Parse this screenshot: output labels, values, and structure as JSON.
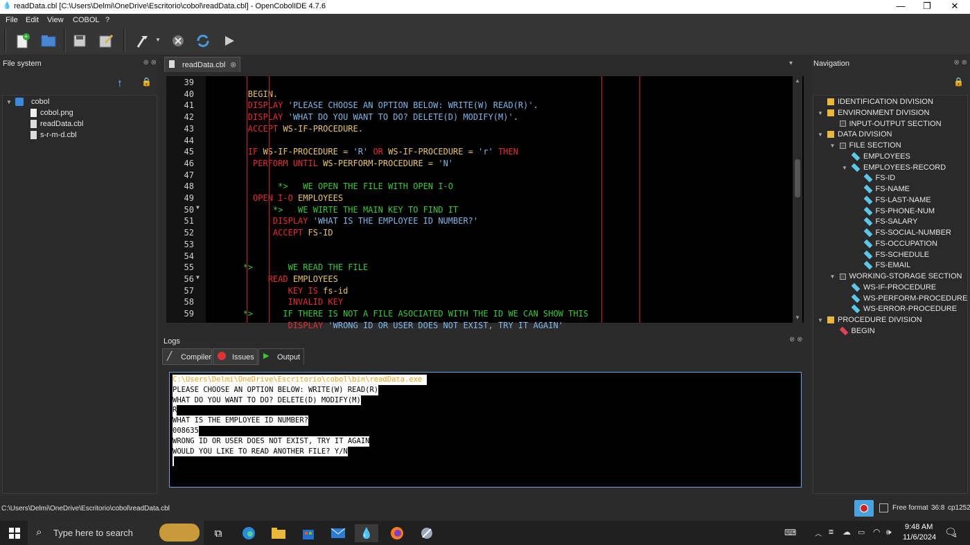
{
  "window": {
    "title": "readData.cbl [C:\\Users\\Delmi\\OneDrive\\Escritorio\\cobol\\readData.cbl] - OpenCobolIDE 4.7.6"
  },
  "menu": [
    "File",
    "Edit",
    "View",
    "COBOL",
    "?"
  ],
  "file_system": {
    "title": "File system",
    "root": "cobol",
    "files": [
      "cobol.png",
      "readData.cbl",
      "s-r-m-d.cbl"
    ]
  },
  "editor": {
    "tab": "readData.cbl",
    "lines": [
      {
        "n": "39",
        "segs": [
          [
            "",
            "w"
          ]
        ]
      },
      {
        "n": "40",
        "segs": [
          [
            "        BEGIN.",
            "y"
          ]
        ]
      },
      {
        "n": "41",
        "segs": [
          [
            "        DISPLAY ",
            "r"
          ],
          [
            "'PLEASE CHOOSE AN OPTION BELOW: WRITE(W) READ(R)'",
            "b"
          ],
          [
            ".",
            "y"
          ]
        ]
      },
      {
        "n": "42",
        "segs": [
          [
            "        DISPLAY ",
            "r"
          ],
          [
            "'WHAT DO YOU WANT TO DO? DELETE(D) MODIFY(M)'",
            "b"
          ],
          [
            ".",
            "y"
          ]
        ]
      },
      {
        "n": "43",
        "segs": [
          [
            "        ACCEPT ",
            "r"
          ],
          [
            "WS-IF-PROCEDURE.",
            "y"
          ]
        ]
      },
      {
        "n": "44",
        "segs": [
          [
            "",
            "w"
          ]
        ]
      },
      {
        "n": "45",
        "segs": [
          [
            "        IF ",
            "r"
          ],
          [
            "WS-IF-PROCEDURE = ",
            "y"
          ],
          [
            "'R'",
            "b"
          ],
          [
            " OR ",
            "r"
          ],
          [
            "WS-IF-PROCEDURE = ",
            "y"
          ],
          [
            "'r'",
            "b"
          ],
          [
            " THEN",
            "r"
          ]
        ]
      },
      {
        "n": "46",
        "segs": [
          [
            "         PERFORM UNTIL ",
            "r"
          ],
          [
            "WS-PERFORM-PROCEDURE = ",
            "y"
          ],
          [
            "'N'",
            "b"
          ]
        ]
      },
      {
        "n": "47",
        "segs": [
          [
            "",
            "w"
          ]
        ]
      },
      {
        "n": "48",
        "segs": [
          [
            "              *>   WE OPEN THE FILE WITH OPEN I-O",
            "g"
          ]
        ]
      },
      {
        "n": "49",
        "segs": [
          [
            "         OPEN I-O ",
            "r"
          ],
          [
            "EMPLOYEES",
            "y"
          ]
        ]
      },
      {
        "n": "50",
        "segs": [
          [
            "             *>   WE WIRTE THE MAIN KEY TO FIND IT",
            "g"
          ]
        ]
      },
      {
        "n": "51",
        "segs": [
          [
            "             DISPLAY ",
            "r"
          ],
          [
            "'WHAT IS THE EMPLOYEE ID NUMBER?'",
            "b"
          ]
        ]
      },
      {
        "n": "52",
        "segs": [
          [
            "             ACCEPT ",
            "r"
          ],
          [
            "FS-ID",
            "y"
          ]
        ]
      },
      {
        "n": "53",
        "segs": [
          [
            "",
            "w"
          ]
        ]
      },
      {
        "n": "54",
        "segs": [
          [
            "",
            "w"
          ]
        ]
      },
      {
        "n": "55",
        "segs": [
          [
            "       *>       WE READ THE FILE",
            "g"
          ]
        ]
      },
      {
        "n": "56",
        "segs": [
          [
            "            READ ",
            "r"
          ],
          [
            "EMPLOYEES",
            "y"
          ]
        ]
      },
      {
        "n": "57",
        "segs": [
          [
            "                KEY IS ",
            "r"
          ],
          [
            "fs-id",
            "y"
          ]
        ]
      },
      {
        "n": "58",
        "segs": [
          [
            "                INVALID KEY",
            "r"
          ]
        ]
      },
      {
        "n": "59",
        "segs": [
          [
            "       *>      IF THERE IS NOT A FILE ASOCIATED WITH THE ID WE CAN SHOW THIS",
            "g"
          ]
        ]
      },
      {
        "n": "",
        "segs": [
          [
            "                DISPLAY ",
            "r"
          ],
          [
            "'WRONG ID OR USER DOES NOT EXIST, TRY IT AGAIN'",
            "b"
          ]
        ]
      }
    ]
  },
  "logs": {
    "title": "Logs",
    "tabs": [
      "Compiler",
      "Issues",
      "Output"
    ],
    "output": [
      "C:\\Users\\Delmi\\OneDrive\\Escritorio\\cobol\\bin\\readData.exe ",
      "PLEASE CHOOSE AN OPTION BELOW: WRITE(W) READ(R)",
      "WHAT DO YOU WANT TO DO? DELETE(D) MODIFY(M)",
      "R",
      "WHAT IS THE EMPLOYEE ID NUMBER?",
      "008635",
      "WRONG ID OR USER DOES NOT EXIST, TRY IT AGAIN",
      "WOULD YOU LIKE TO READ ANOTHER FILE? Y/N",
      ""
    ]
  },
  "navigation": {
    "title": "Navigation",
    "items": [
      {
        "label": "IDENTIFICATION DIVISION",
        "level": 0,
        "kind": "division",
        "arrow": ""
      },
      {
        "label": "ENVIRONMENT DIVISION",
        "level": 0,
        "kind": "division",
        "arrow": "v"
      },
      {
        "label": "INPUT-OUTPUT SECTION",
        "level": 1,
        "kind": "section",
        "arrow": ""
      },
      {
        "label": "DATA DIVISION",
        "level": 0,
        "kind": "division",
        "arrow": "v"
      },
      {
        "label": "FILE SECTION",
        "level": 1,
        "kind": "section",
        "arrow": "v"
      },
      {
        "label": "EMPLOYEES",
        "level": 2,
        "kind": "var",
        "arrow": ""
      },
      {
        "label": "EMPLOYEES-RECORD",
        "level": 2,
        "kind": "var",
        "arrow": "v"
      },
      {
        "label": "FS-ID",
        "level": 3,
        "kind": "var",
        "arrow": ""
      },
      {
        "label": "FS-NAME",
        "level": 3,
        "kind": "var",
        "arrow": ""
      },
      {
        "label": "FS-LAST-NAME",
        "level": 3,
        "kind": "var",
        "arrow": ""
      },
      {
        "label": "FS-PHONE-NUM",
        "level": 3,
        "kind": "var",
        "arrow": ""
      },
      {
        "label": "FS-SALARY",
        "level": 3,
        "kind": "var",
        "arrow": ""
      },
      {
        "label": "FS-SOCIAL-NUMBER",
        "level": 3,
        "kind": "var",
        "arrow": ""
      },
      {
        "label": "FS-OCCUPATION",
        "level": 3,
        "kind": "var",
        "arrow": ""
      },
      {
        "label": "FS-SCHEDULE",
        "level": 3,
        "kind": "var",
        "arrow": ""
      },
      {
        "label": "FS-EMAIL",
        "level": 3,
        "kind": "var",
        "arrow": ""
      },
      {
        "label": "WORKING-STORAGE SECTION",
        "level": 1,
        "kind": "section",
        "arrow": "v"
      },
      {
        "label": "WS-IF-PROCEDURE",
        "level": 2,
        "kind": "var",
        "arrow": ""
      },
      {
        "label": "WS-PERFORM-PROCEDURE",
        "level": 2,
        "kind": "var",
        "arrow": ""
      },
      {
        "label": "WS-ERROR-PROCEDURE",
        "level": 2,
        "kind": "var",
        "arrow": ""
      },
      {
        "label": "PROCEDURE DIVISION",
        "level": 0,
        "kind": "division",
        "arrow": "v"
      },
      {
        "label": "BEGIN",
        "level": 1,
        "kind": "para",
        "arrow": ""
      }
    ]
  },
  "status": {
    "path": "C:\\Users\\Delmi\\OneDrive\\Escritorio\\cobol\\readData.cbl",
    "free_format": "Free format",
    "position": "36:8",
    "encoding": "cp1252"
  },
  "taskbar": {
    "search_placeholder": "Type here to search",
    "time": "9:48 AM",
    "date": "11/6/2024",
    "notifications": "4"
  },
  "colors": {
    "keyword": "#e23030",
    "identifier": "#e8c46a",
    "comment": "#3ac83a",
    "string": "#7fb7e8",
    "accent": "#6aa7e0"
  }
}
